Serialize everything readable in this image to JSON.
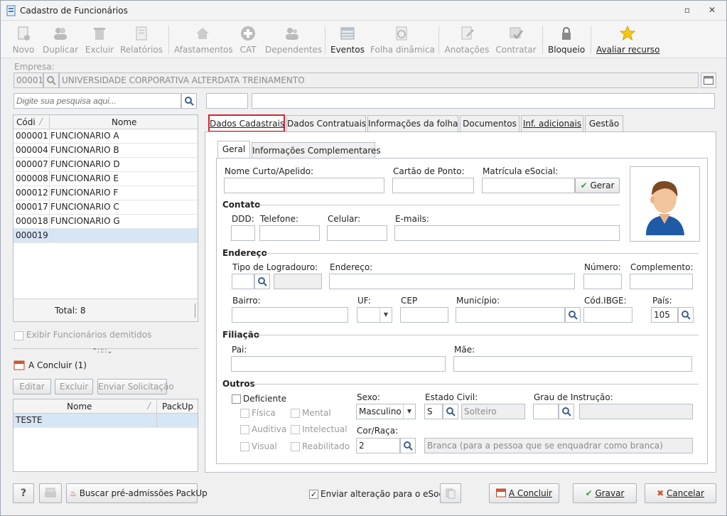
{
  "window": {
    "title": "Cadastro de Funcionários"
  },
  "toolbar": {
    "novo": "Novo",
    "duplicar": "Duplicar",
    "excluir": "Excluir",
    "relatorios": "Relatórios",
    "afastamentos": "Afastamentos",
    "cat": "CAT",
    "dependentes": "Dependentes",
    "eventos": "Eventos",
    "folha_dinamica": "Folha dinâmica",
    "anotacoes": "Anotações",
    "contratar": "Contratar",
    "bloqueio": "Bloqueio",
    "avaliar_recurso": "Avaliar recurso"
  },
  "empresa": {
    "label": "Empresa:",
    "code": "00001",
    "name": "UNIVERSIDADE CORPORATIVA ALTERDATA TREINAMENTO"
  },
  "search": {
    "placeholder": "Digite sua pesquisa aqui..."
  },
  "list": {
    "col_code": "Códi",
    "col_name": "Nome",
    "rows": [
      {
        "code": "000001",
        "name": "FUNCIONARIO A"
      },
      {
        "code": "000004",
        "name": "FUNCIONARIO B"
      },
      {
        "code": "000007",
        "name": "FUNCIONARIO D"
      },
      {
        "code": "000008",
        "name": "FUNCIONARIO E"
      },
      {
        "code": "000012",
        "name": "FUNCIONARIO F"
      },
      {
        "code": "000017",
        "name": "FUNCIONARIO C"
      },
      {
        "code": "000018",
        "name": "FUNCIONARIO G"
      },
      {
        "code": "000019",
        "name": ""
      }
    ],
    "total": "Total: 8"
  },
  "left": {
    "exibir_demitidos": "Exibir Funcionários demitidos",
    "a_concluir": "A Concluir (1)",
    "editar": "Editar",
    "excluir": "Excluir",
    "enviar_solicitacao": "Enviar Solicitação",
    "pending_col_nome": "Nome",
    "pending_col_packup": "PackUp",
    "pending_row": "TESTE"
  },
  "tabs": {
    "dados_cadastrais": "Dados Cadastrais",
    "dados_contratuais": "Dados Contratuais",
    "informacoes_folha": "Informações da folha",
    "documentos": "Documentos",
    "inf_adicionais": "Inf. adicionais",
    "gestao": "Gestão"
  },
  "subtabs": {
    "geral": "Geral",
    "info_complementares": "Informações Complementares"
  },
  "form": {
    "nome_curto": "Nome Curto/Apelido:",
    "cartao_ponto": "Cartão de Ponto:",
    "matricula_esocial": "Matrícula eSocial:",
    "gerar": "Gerar",
    "contato": "Contato",
    "ddd": "DDD:",
    "telefone": "Telefone:",
    "celular": "Celular:",
    "emails": "E-mails:",
    "endereco_section": "Endereço",
    "tipo_logradouro": "Tipo de Logradouro:",
    "endereco": "Endereço:",
    "numero": "Número:",
    "complemento": "Complemento:",
    "bairro": "Bairro:",
    "uf": "UF:",
    "cep": "CEP",
    "municipio": "Município:",
    "cod_ibge": "Cód.IBGE:",
    "pais": "País:",
    "pais_value": "105",
    "filiacao": "Filiação",
    "pai": "Pai:",
    "mae": "Mãe:",
    "outros": "Outros",
    "deficiente": "Deficiente",
    "fisica": "Física",
    "mental": "Mental",
    "auditiva": "Auditiva",
    "intelectual": "Intelectual",
    "visual": "Visual",
    "reabilitado": "Reabilitado",
    "sexo": "Sexo:",
    "sexo_value": "Masculino",
    "estado_civil": "Estado Civil:",
    "estado_civil_code": "S",
    "estado_civil_desc": "Solteiro",
    "grau_instrucao": "Grau de Instrução:",
    "cor_raca": "Cor/Raça:",
    "cor_raca_code": "2",
    "cor_raca_desc": "Branca (para a pessoa que se enquadrar como branca)"
  },
  "footer": {
    "help": "?",
    "buscar_pre_admissoes": "Buscar pré-admissões PackUp",
    "enviar_esocial": "Enviar alteração para o eSocial",
    "a_concluir": "A Concluir",
    "gravar": "Gravar",
    "cancelar": "Cancelar"
  }
}
